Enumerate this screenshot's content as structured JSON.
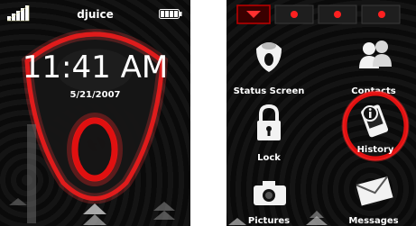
{
  "lock_screen": {
    "operator": "djuice",
    "time": "11:41 AM",
    "date": "5/21/2007"
  },
  "menu": {
    "items": [
      {
        "label": "Status Screen",
        "icon": "status-screen-icon"
      },
      {
        "label": "Contacts",
        "icon": "contacts-icon"
      },
      {
        "label": "Lock",
        "icon": "lock-icon"
      },
      {
        "label": "History",
        "icon": "history-icon"
      },
      {
        "label": "Pictures",
        "icon": "camera-icon"
      },
      {
        "label": "Messages",
        "icon": "envelope-icon"
      }
    ],
    "selected": "History"
  },
  "colors": {
    "accent": "#e01010",
    "background": "#0c0c0c",
    "text": "#ffffff"
  }
}
